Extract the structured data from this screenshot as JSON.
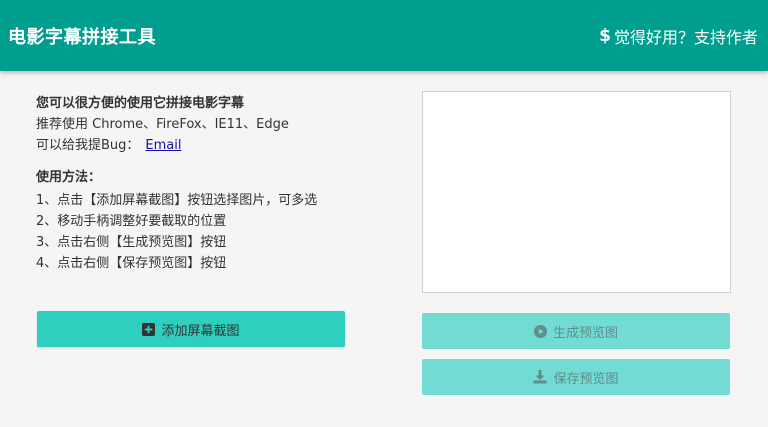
{
  "header": {
    "title": "电影字幕拼接工具",
    "support_label": "觉得好用？支持作者",
    "support_icon": "dollar-icon"
  },
  "intro": {
    "lead": "您可以很方便的使用它拼接电影字幕",
    "browsers": "推荐使用 Chrome、FireFox、IE11、Edge",
    "bug_prefix": "可以给我提Bug：",
    "email_label": "Email"
  },
  "method": {
    "title": "使用方法：",
    "steps": [
      "1、点击【添加屏幕截图】按钮选择图片，可多选",
      "2、移动手柄调整好要截取的位置",
      "3、点击右侧【生成预览图】按钮",
      "4、点击右侧【保存预览图】按钮"
    ]
  },
  "buttons": {
    "add_label": "添加屏幕截图",
    "add_icon": "plus-square-icon",
    "generate_label": "生成预览图",
    "generate_icon": "play-circle-icon",
    "save_label": "保存预览图",
    "save_icon": "download-icon"
  },
  "colors": {
    "header_bg": "#009e8f",
    "primary_button": "#2fcfbf",
    "disabled_button": "#72dbd3"
  }
}
